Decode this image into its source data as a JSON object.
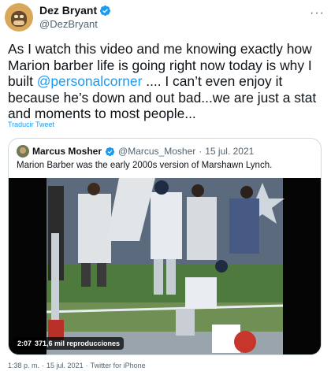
{
  "author": {
    "display_name": "Dez Bryant",
    "handle": "@DezBryant",
    "avatar_icon": "bored-ape-avatar-icon"
  },
  "tweet": {
    "text_before": "As I watch this video and me knowing exactly how Marion barber life is going right now today is why I built ",
    "mention": "@personalcorner",
    "text_after": " .... I can’t even enjoy it because he’s down and out bad...we are just a stat and moments to most people...",
    "translate_label": "Traducir Tweet"
  },
  "quoted": {
    "display_name": "Marcus Mosher",
    "handle": "@Marcus_Mosher",
    "separator": "·",
    "date": "15 jul. 2021",
    "text": "Marion Barber was the early 2000s version of Marshawn Lynch."
  },
  "video": {
    "duration": "2:07",
    "views": "371,6 mil reproducciones"
  },
  "footer": {
    "time": "1:38 p. m.",
    "separator": "·",
    "date": "15 jul. 2021",
    "separator2": "·",
    "source": "Twitter for iPhone"
  },
  "colors": {
    "link": "#1d9bf0",
    "verified": "#1d9bf0",
    "secondary_text": "#536471"
  }
}
